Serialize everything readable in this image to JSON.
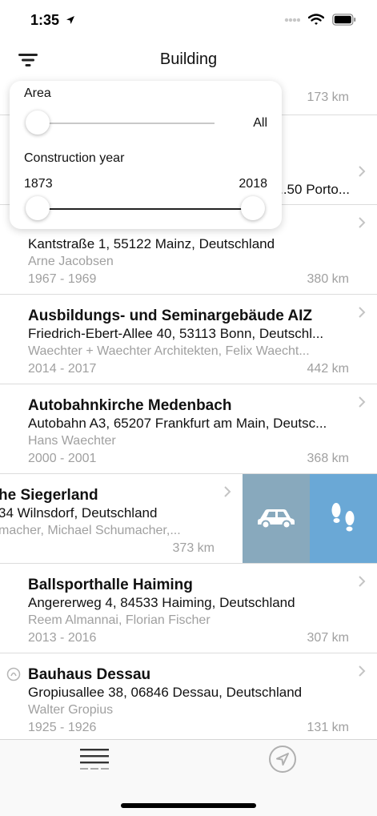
{
  "status": {
    "time": "1:35"
  },
  "nav": {
    "title": "Building"
  },
  "filter": {
    "area": {
      "label": "Area",
      "value": "All",
      "position": 0
    },
    "year": {
      "label": "Construction year",
      "min": "1873",
      "max": "2018",
      "low_position": 0,
      "high_position": 1
    }
  },
  "rows": {
    "r0": {
      "distance": "173 km"
    },
    "r1": {
      "address": "...50 Porto..."
    },
    "r2": {
      "address": "Kantstraße 1, 55122 Mainz, Deutschland",
      "architect": "Arne Jacobsen",
      "years": "1967 - 1969",
      "distance": "380 km"
    },
    "r3": {
      "title": "Ausbildungs- und Seminargebäude AIZ",
      "address": "Friedrich-Ebert-Allee 40, 53113 Bonn, Deutschl...",
      "architect": "Waechter + Waechter Architekten, Felix Waecht...",
      "years": "2014 - 2017",
      "distance": "442 km"
    },
    "r4": {
      "title": "Autobahnkirche Medenbach",
      "address": "Autobahn A3, 65207 Frankfurt am Main, Deutsc...",
      "architect": "Hans Waechter",
      "years": "2000 - 2001",
      "distance": "368 km"
    },
    "r5": {
      "title": "he Siegerland",
      "address": "34 Wilnsdorf, Deutschland",
      "architect": "macher, Michael Schumacher,...",
      "distance": "373 km"
    },
    "r6": {
      "title": "Ballsporthalle Haiming",
      "address": "Angererweg 4, 84533 Haiming, Deutschland",
      "architect": "Reem Almannai, Florian Fischer",
      "years": "2013 - 2016",
      "distance": "307 km"
    },
    "r7": {
      "title": "Bauhaus Dessau",
      "address": "Gropiusallee 38, 06846 Dessau, Deutschland",
      "architect": "Walter Gropius",
      "years": "1925 - 1926",
      "distance": "131 km"
    }
  },
  "icons": {
    "filter": "filter-icon",
    "chevron": "chevron-right-icon",
    "car": "car-icon",
    "walk": "footsteps-icon",
    "list_tab": "list-icon",
    "navigate_tab": "location-arrow-icon"
  },
  "colors": {
    "car_action": "#88a9bd",
    "walk_action": "#6aa8d6",
    "secondary_text": "#a0a0a0"
  }
}
